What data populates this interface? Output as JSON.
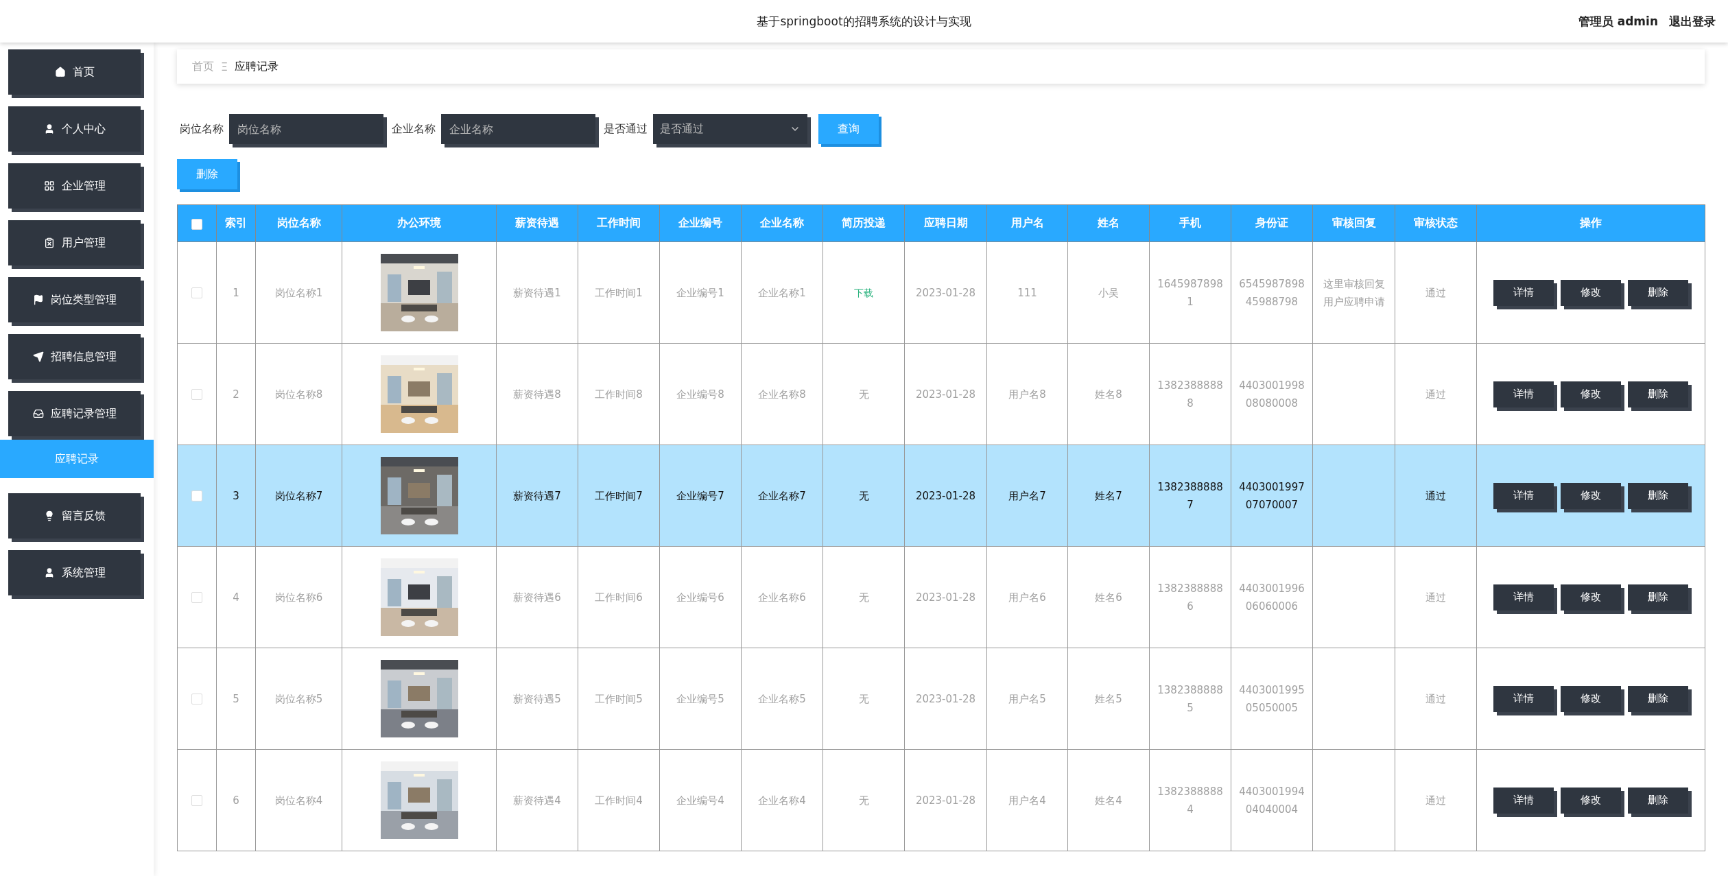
{
  "header": {
    "title": "基于springboot的招聘系统的设计与实现",
    "user": "管理员 admin",
    "logout": "退出登录"
  },
  "sidebar": {
    "items": [
      {
        "label": "首页",
        "selected": false
      },
      {
        "label": "个人中心",
        "selected": false
      },
      {
        "label": "企业管理",
        "selected": false
      },
      {
        "label": "用户管理",
        "selected": false
      },
      {
        "label": "岗位类型管理",
        "selected": false
      },
      {
        "label": "招聘信息管理",
        "selected": false
      },
      {
        "label": "应聘记录管理",
        "selected": false,
        "children": [
          {
            "label": "应聘记录",
            "selected": true
          }
        ]
      },
      {
        "label": "留言反馈",
        "selected": false
      },
      {
        "label": "系统管理",
        "selected": false
      }
    ]
  },
  "breadcrumb": {
    "home": "首页",
    "separator": "Ξ",
    "current": "应聘记录"
  },
  "filters": [
    {
      "kind": "input",
      "label": "岗位名称",
      "placeholder": "岗位名称"
    },
    {
      "kind": "input",
      "label": "企业名称",
      "placeholder": "企业名称"
    },
    {
      "kind": "select",
      "label": "是否通过",
      "placeholder": "是否通过"
    }
  ],
  "search_button": "查询",
  "delete_button": "删除",
  "table": {
    "header_checked": false,
    "columns": [
      "索引",
      "岗位名称",
      "办公环境",
      "薪资待遇",
      "工作时间",
      "企业编号",
      "企业名称",
      "简历投递",
      "应聘日期",
      "用户名",
      "姓名",
      "手机",
      "身份证",
      "审核回复",
      "审核状态",
      "操作"
    ],
    "rows": [
      {
        "selected": false,
        "checked": false,
        "index": "1",
        "job": "岗位名称1",
        "salary": "薪资待遇1",
        "time": "工作时间1",
        "company_no": "企业编号1",
        "company": "企业名称1",
        "resume": {
          "text": "下载",
          "kind": "link"
        },
        "date": "2023-01-28",
        "username": "111",
        "name": "小吴",
        "phone": "16459878981",
        "id_card": "654598789845988798",
        "reply": "这里审核回复用户应聘申请",
        "status": "通过",
        "actions": [
          "详情",
          "修改",
          "删除"
        ]
      },
      {
        "selected": false,
        "checked": false,
        "index": "2",
        "job": "岗位名称8",
        "salary": "薪资待遇8",
        "time": "工作时间8",
        "company_no": "企业编号8",
        "company": "企业名称8",
        "resume": {
          "text": "无",
          "kind": "text"
        },
        "date": "2023-01-28",
        "username": "用户名8",
        "name": "姓名8",
        "phone": "13823888888",
        "id_card": "440300199808080008",
        "status": "通过",
        "actions": [
          "详情",
          "修改",
          "删除"
        ]
      },
      {
        "selected": true,
        "checked": false,
        "index": "3",
        "job": "岗位名称7",
        "salary": "薪资待遇7",
        "time": "工作时间7",
        "company_no": "企业编号7",
        "company": "企业名称7",
        "resume": {
          "text": "无",
          "kind": "text"
        },
        "date": "2023-01-28",
        "username": "用户名7",
        "name": "姓名7",
        "phone": "13823888887",
        "id_card": "440300199707070007",
        "status": "通过",
        "actions": [
          "详情",
          "修改",
          "删除"
        ]
      },
      {
        "selected": false,
        "checked": false,
        "index": "4",
        "job": "岗位名称6",
        "salary": "薪资待遇6",
        "time": "工作时间6",
        "company_no": "企业编号6",
        "company": "企业名称6",
        "resume": {
          "text": "无",
          "kind": "text"
        },
        "date": "2023-01-28",
        "username": "用户名6",
        "name": "姓名6",
        "phone": "13823888886",
        "id_card": "440300199606060006",
        "status": "通过",
        "actions": [
          "详情",
          "修改",
          "删除"
        ]
      },
      {
        "selected": false,
        "checked": false,
        "index": "5",
        "job": "岗位名称5",
        "salary": "薪资待遇5",
        "time": "工作时间5",
        "company_no": "企业编号5",
        "company": "企业名称5",
        "resume": {
          "text": "无",
          "kind": "text"
        },
        "date": "2023-01-28",
        "username": "用户名5",
        "name": "姓名5",
        "phone": "13823888885",
        "id_card": "440300199505050005",
        "status": "通过",
        "actions": [
          "详情",
          "修改",
          "删除"
        ]
      },
      {
        "selected": false,
        "checked": false,
        "index": "6",
        "job": "岗位名称4",
        "salary": "薪资待遇4",
        "time": "工作时间4",
        "company_no": "企业编号4",
        "company": "企业名称4",
        "resume": {
          "text": "无",
          "kind": "text"
        },
        "date": "2023-01-28",
        "username": "用户名4",
        "name": "姓名4",
        "phone": "13823888884",
        "id_card": "440300199404040004",
        "status": "通过",
        "actions": [
          "详情",
          "修改",
          "删除"
        ]
      }
    ]
  }
}
